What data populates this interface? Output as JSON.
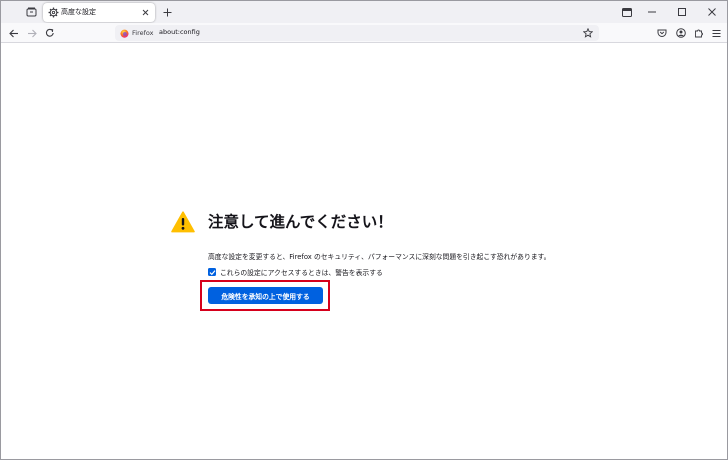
{
  "tab": {
    "title": "高度な設定",
    "icon": "gear-icon"
  },
  "navbar": {
    "identity_label": "Firefox",
    "url": "about:config"
  },
  "warning": {
    "heading": "注意して進んでください！",
    "description": "高度な設定を変更すると、Firefox のセキュリティ、パフォーマンスに深刻な問題を引き起こす恐れがあります。",
    "checkbox_label": "これらの設定にアクセスするときは、警告を表示する",
    "checkbox_checked": true,
    "accept_button": "危険性を承知の上で使用する"
  },
  "colors": {
    "accent": "#0061e0",
    "warning": "#ffbf00",
    "highlight": "#d6001c",
    "tabstrip": "#f0f0f4"
  }
}
